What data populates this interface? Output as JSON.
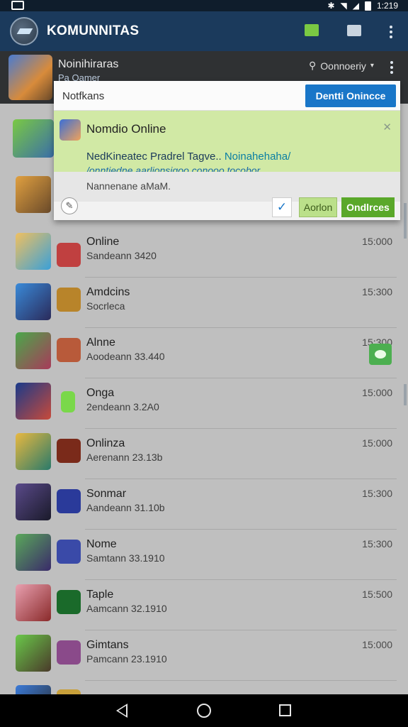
{
  "status": {
    "time": "1:219",
    "icons": [
      "gallery-icon",
      "bluetooth-icon",
      "wifi-icon",
      "signal-icon",
      "battery-icon"
    ]
  },
  "appbar": {
    "title": "KOMUNNITAS",
    "icons": [
      "logo-icon",
      "chat-icon",
      "camera-icon",
      "overflow-icon"
    ]
  },
  "subbar": {
    "name": "Noinihiraras",
    "sub": "Pa Oamer",
    "search_label": "Oonnoeriy"
  },
  "dialog": {
    "header_label": "Notfkans",
    "header_button": "Dentti Onincce",
    "notification": {
      "title": "Nomdio Online",
      "body_plain": "NedKineatec Pradrel Tagve..",
      "body_highlight": "Noinahehaha/",
      "body_line2": "/onntiedne aarlionsigoo conooo tocobor.",
      "meta": "Nannenane aMaM."
    },
    "actions": {
      "check": "✓",
      "secondary": "Aorlon",
      "primary": "Ondlrces"
    }
  },
  "list": [
    {
      "title": "Online",
      "sub": "Sandeann 3420",
      "time": "15:000"
    },
    {
      "title": "Amdcins",
      "sub": "Socrleca",
      "time": "15:300"
    },
    {
      "title": "Alnne",
      "sub": "Aoodeann 33.440",
      "time": "15:300"
    },
    {
      "title": "Onga",
      "sub": "2endeann 3.2A0",
      "time": "15:000"
    },
    {
      "title": "Onlinza",
      "sub": "Aerenann 23.13b",
      "time": "15:000"
    },
    {
      "title": "Sonmar",
      "sub": "Aandeann 31.10b",
      "time": "15:300"
    },
    {
      "title": "Nome",
      "sub": "Samtann 33.1910",
      "time": "15:300"
    },
    {
      "title": "Taple",
      "sub": "Aamcann 32.1910",
      "time": "15:500"
    },
    {
      "title": "Gimtans",
      "sub": "Pamcann 23.1910",
      "time": "15:000"
    }
  ],
  "colors": {
    "appbar": "#1b3a5c",
    "notification": "#d1e9a5",
    "primary_action": "#5aa82a",
    "header_button": "#1976c8"
  }
}
